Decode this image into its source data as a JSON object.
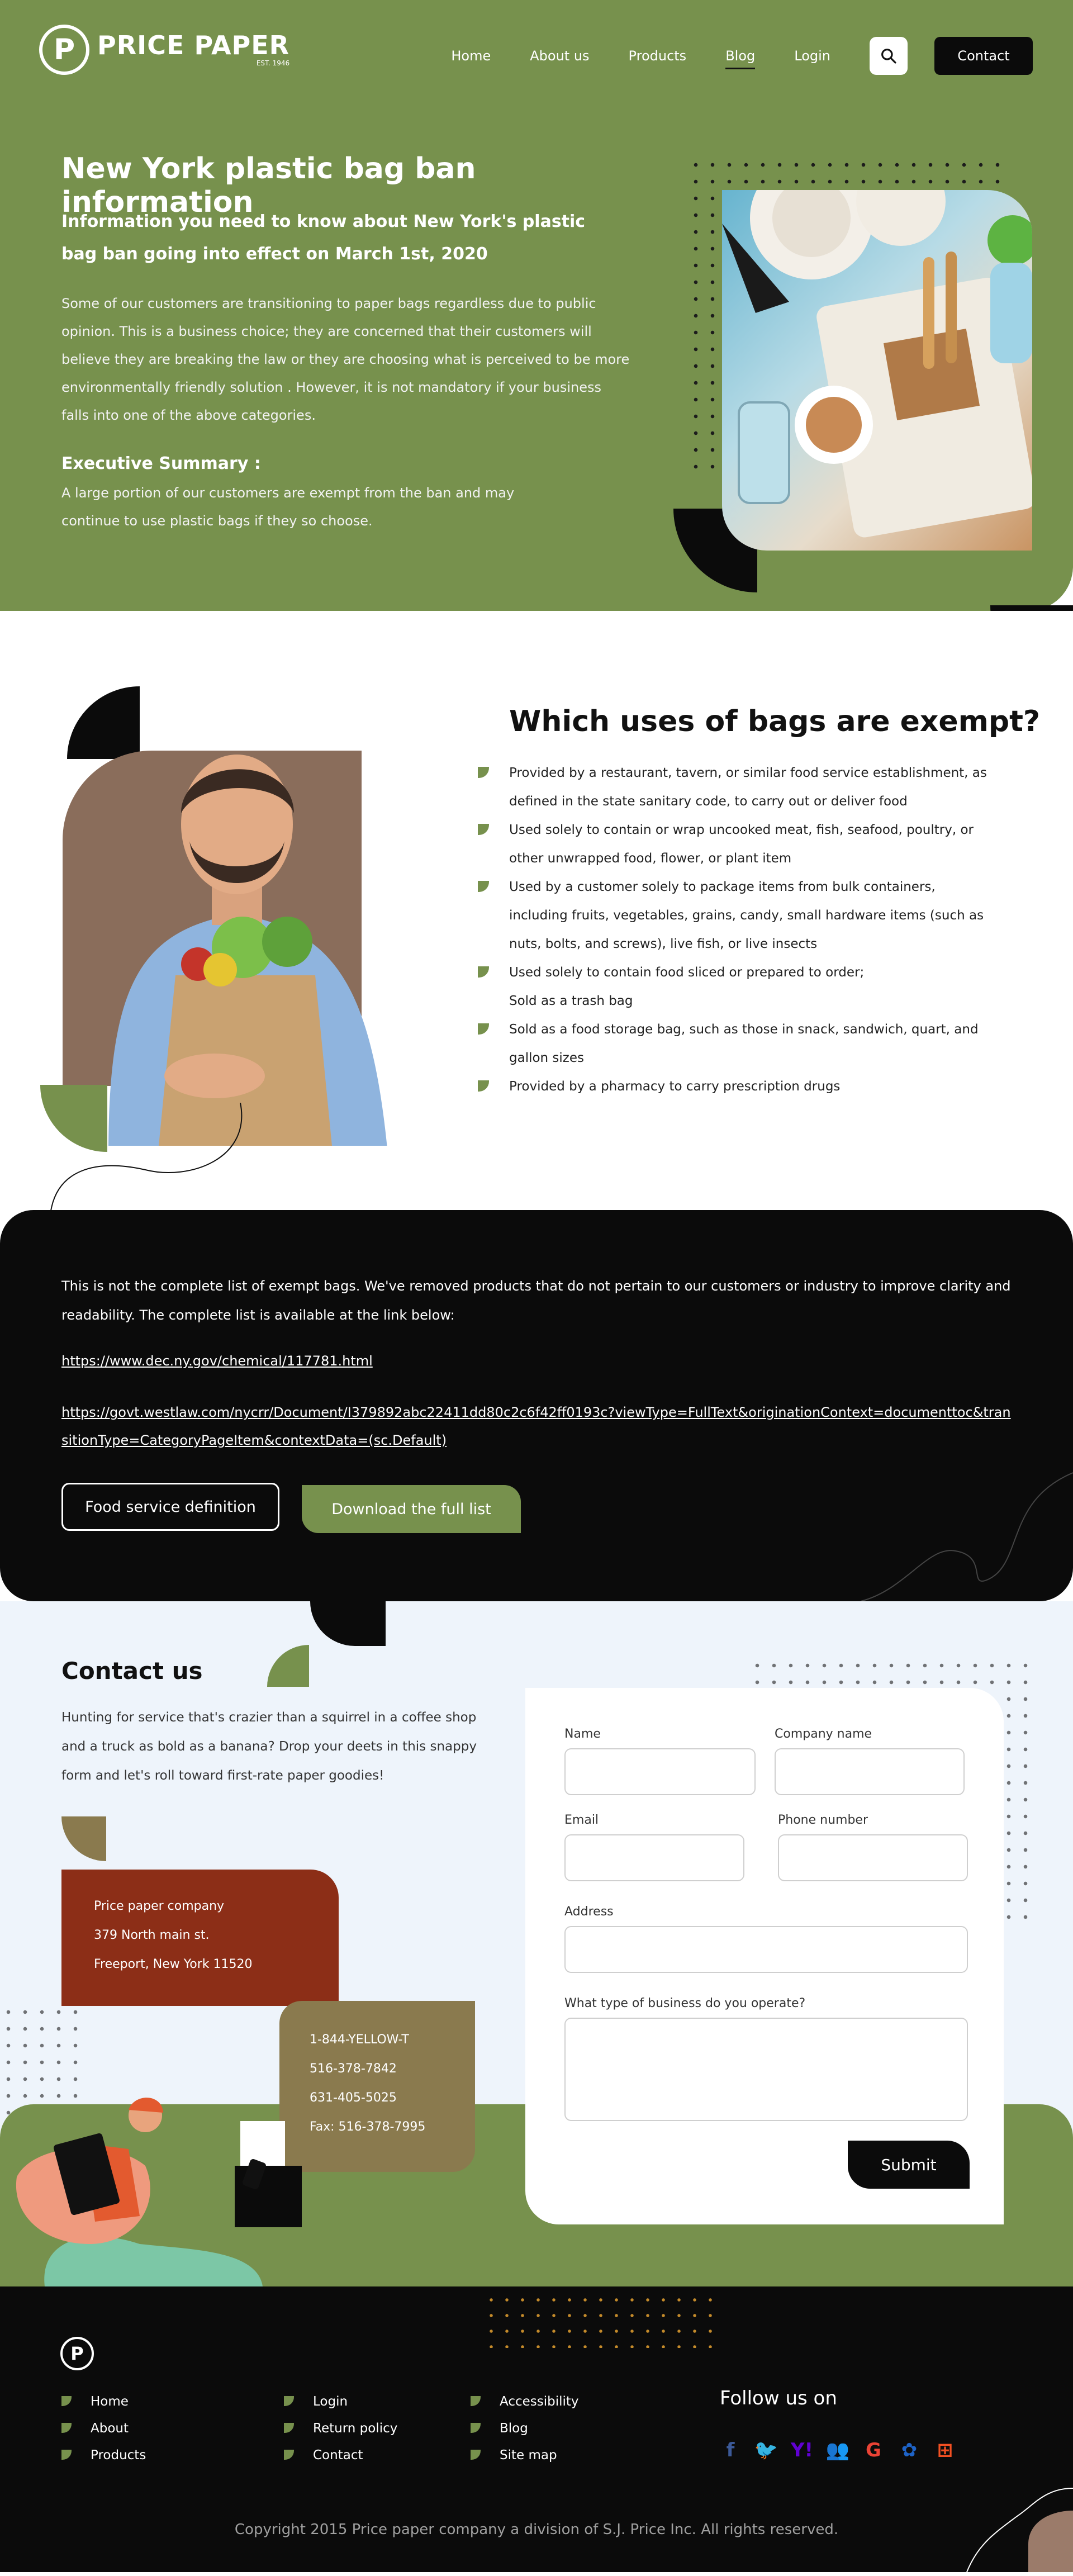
{
  "brand": {
    "name": "PRICE PAPER",
    "sub": "EST. 1946",
    "mark": "P"
  },
  "nav": {
    "items": [
      {
        "label": "Home"
      },
      {
        "label": "About us"
      },
      {
        "label": "Products"
      },
      {
        "label": "Blog",
        "active": true
      },
      {
        "label": "Login"
      }
    ],
    "search_icon": "search-icon",
    "contact_label": "Contact"
  },
  "hero": {
    "title": "New York plastic bag ban information",
    "subtitle": "Information you need to know about New York's plastic bag ban going into effect on March 1st, 2020",
    "body": "Some of our customers are transitioning to paper bags regardless due to public opinion. This is a business choice; they are concerned that their customers will believe they are breaking the law or they are choosing what is perceived to be more environmentally friendly solution . However, it is not mandatory if your business falls into one of the above categories.",
    "exec_title": "Executive Summary :",
    "exec_body": "A large portion of our customers are exempt from the ban and may continue to use plastic bags if they so choose."
  },
  "exempt": {
    "title": "Which uses of bags are exempt?",
    "items": [
      "Provided by a restaurant, tavern, or similar food service establishment, as defined in the state sanitary code, to carry out or deliver food",
      "Used solely to contain or wrap uncooked meat, fish, seafood, poultry, or other unwrapped food, flower, or plant item",
      "Used by a customer solely to package items from bulk containers, including fruits, vegetables, grains, candy, small hardware items (such as nuts, bolts, and screws), live fish, or live insects",
      "Used solely to contain food sliced or prepared to order;",
      "Sold as a trash bag",
      "Sold as a food storage bag, such as those in snack, sandwich, quart, and gallon sizes",
      "Provided by a pharmacy to carry prescription drugs"
    ]
  },
  "links": {
    "note": "This is not the complete list of exempt bags. We've removed products that do not pertain to our customers or industry to improve clarity and readability. The complete list is available at the link below:",
    "url1": "https://www.dec.ny.gov/chemical/117781.html",
    "url2": "https://govt.westlaw.com/nycrr/Document/I379892abc22411dd80c2c6f42ff0193c?viewType=FullText&originationContext=documenttoc&transitionType=CategoryPageItem&contextData=(sc.Default)",
    "btn_definition": "Food service definition",
    "btn_download": "Download the full list"
  },
  "contact": {
    "title": "Contact us",
    "body": "Hunting for service that's crazier than a squirrel in a coffee shop and a truck as bold as a banana? Drop your deets in this snappy form and let's roll toward first-rate paper goodies!",
    "address": [
      "Price paper company",
      "379 North main st.",
      "Freeport, New York 11520"
    ],
    "phones": [
      "1-844-YELLOW-T",
      "516-378-7842",
      "631-405-5025",
      "Fax: 516-378-7995"
    ],
    "form": {
      "name_label": "Name",
      "company_label": "Company name",
      "email_label": "Email",
      "phone_label": "Phone number",
      "address_label": "Address",
      "business_label": "What type of business do you operate?",
      "submit_label": "Submit"
    }
  },
  "footer": {
    "col1": [
      "Home",
      "About",
      "Products"
    ],
    "col2": [
      "Login",
      "Return policy",
      "Contact"
    ],
    "col3": [
      "Accessibility",
      "Blog",
      "Site map"
    ],
    "follow": "Follow us on",
    "social": [
      {
        "icon": "facebook-icon",
        "glyph": "f",
        "color": "#3b5998"
      },
      {
        "icon": "twitter-icon",
        "glyph": "🐦",
        "color": "#1da1f2"
      },
      {
        "icon": "yahoo-icon",
        "glyph": "Y!",
        "color": "#6001d2"
      },
      {
        "icon": "myspace-icon",
        "glyph": "👥",
        "color": "#3b5998"
      },
      {
        "icon": "google-icon",
        "glyph": "G",
        "color": "#ea4335"
      },
      {
        "icon": "msn-icon",
        "glyph": "✿",
        "color": "#1e63c7"
      },
      {
        "icon": "windows-icon",
        "glyph": "⊞",
        "color": "#f25022"
      }
    ],
    "copyright": "Copyright 2015 Price paper company a division of S.J. Price Inc. All rights reserved."
  },
  "colors": {
    "green": "#77914d",
    "black": "#0b0b0b",
    "rust": "#8c2e17",
    "olive": "#8a7a4e",
    "light_bg": "#eef4fb"
  }
}
